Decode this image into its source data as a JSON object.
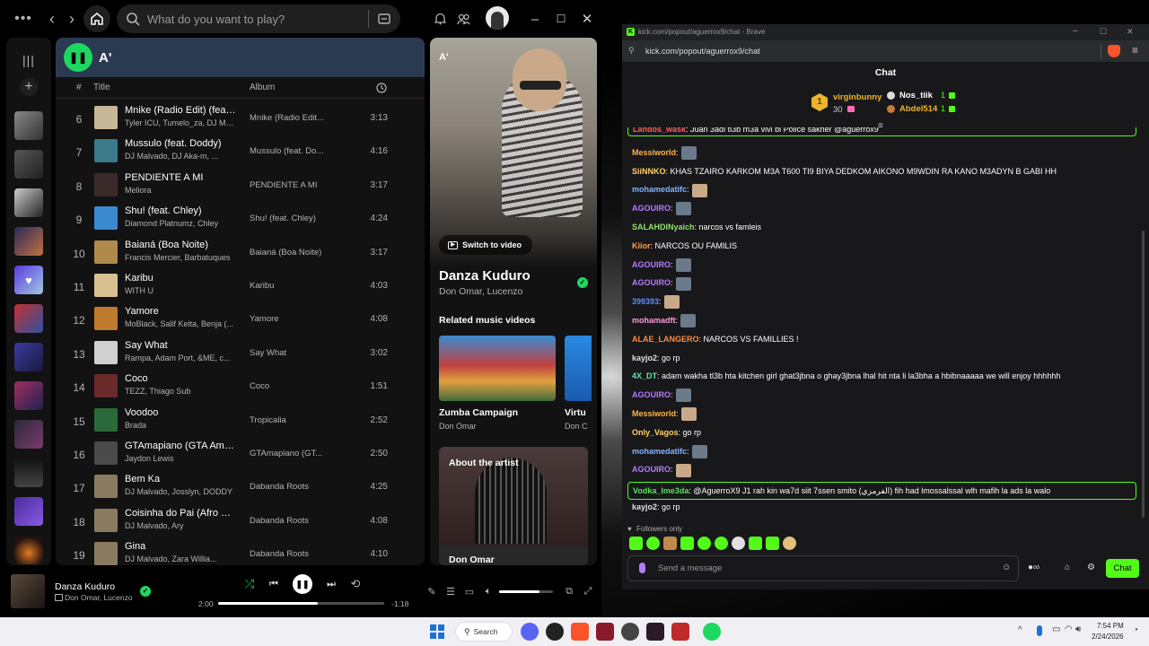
{
  "spotify": {
    "search_placeholder": "What do you want to play?",
    "playlist_title": "A'",
    "columns": {
      "num": "#",
      "title": "Title",
      "album": "Album"
    },
    "tracks": [
      {
        "num": "6",
        "title": "Mnike (Radio Edit) (feat....",
        "artist": "Tyler ICU, Tumelo_za, DJ Ma...",
        "album": "Mnike (Radio Edit...",
        "duration": "3:13",
        "color": "#c9b79a"
      },
      {
        "num": "7",
        "title": "Mussulo (feat. Doddy)",
        "artist": "DJ Malvado, DJ Aka-m, ...",
        "album": "Mussulo (feat. Do...",
        "duration": "4:16",
        "color": "#3a7a8a"
      },
      {
        "num": "8",
        "title": "PENDIENTE A MI",
        "artist": "Meliora",
        "album": "PENDIENTE A MI",
        "duration": "3:17",
        "color": "#3a2a2a"
      },
      {
        "num": "9",
        "title": "Shu! (feat. Chley)",
        "artist": "Diamond Platnumz, Chley",
        "album": "Shu! (feat. Chley)",
        "duration": "4:24",
        "color": "#3a8ad0"
      },
      {
        "num": "10",
        "title": "Baianá (Boa Noite)",
        "artist": "Francis Mercier, Barbatuques",
        "album": "Baianá (Boa Noite)",
        "duration": "3:17",
        "color": "#b08a4a"
      },
      {
        "num": "11",
        "title": "Karibu",
        "artist": "WITH U",
        "album": "Karibu",
        "duration": "4:03",
        "color": "#d8c090"
      },
      {
        "num": "12",
        "title": "Yamore",
        "artist": "MoBlack, Salif Keita, Benja (...",
        "album": "Yamore",
        "duration": "4:08",
        "color": "#c07a30"
      },
      {
        "num": "13",
        "title": "Say What",
        "artist": "Rampa, Adam Port, &ME, c...",
        "album": "Say What",
        "duration": "3:02",
        "color": "#d0d0d0"
      },
      {
        "num": "14",
        "title": "Coco",
        "artist": "TEZZ, Thiago Sub",
        "album": "Coco",
        "duration": "1:51",
        "color": "#6a2a2a"
      },
      {
        "num": "15",
        "title": "Voodoo",
        "artist": "Brada",
        "album": "Tropicalia",
        "duration": "2:52",
        "color": "#2a6a3a"
      },
      {
        "num": "16",
        "title": "GTAmapiano (GTA Ama...",
        "artist": "Jaydon Lewis",
        "album": "GTAmapiano (GT...",
        "duration": "2:50",
        "color": "#4a4a4a"
      },
      {
        "num": "17",
        "title": "Bem Ka",
        "artist": "DJ Malvado, Josslyn, DODDY",
        "album": "Dabanda Roots",
        "duration": "4:25",
        "color": "#8a7a60"
      },
      {
        "num": "18",
        "title": "Coisinha do Pai (Afro Sa...",
        "artist": "DJ Malvado, Ary",
        "album": "Dabanda Roots",
        "duration": "4:08",
        "color": "#8a7a60"
      },
      {
        "num": "19",
        "title": "Gina",
        "artist": "DJ Malvado, Zara Willia...",
        "album": "Dabanda Roots",
        "duration": "4:10",
        "color": "#8a7a60"
      }
    ],
    "np_panel": {
      "title": "A'",
      "switch_video": "Switch to video",
      "song": "Danza Kuduro",
      "artists": "Don Omar, Lucenzo",
      "related": "Related music videos",
      "video1_title": "Zumba Campaign",
      "video1_artist": "Don Omar",
      "video2_title": "Virtu",
      "video2_artist": "Don C",
      "about": "About the artist",
      "about_name": "Don Omar"
    },
    "player": {
      "song": "Danza Kuduro",
      "artists": "Don Omar, Lucenzo",
      "elapsed": "2:00",
      "remaining": "-1:18",
      "progress": 0.6,
      "volume": 0.75
    }
  },
  "kick": {
    "window_title": "kick.com/popout/aguerrox9/chat - Brave",
    "url": "kick.com/popout/aguerrox9/chat",
    "header": "Chat",
    "leaderboard": [
      {
        "name": "virginbunny",
        "count": "30"
      },
      {
        "name": "Nos_tiik",
        "count": "1"
      },
      {
        "name": "Abdel514",
        "count": "1"
      }
    ],
    "messages": [
      {
        "user": "Landos_wask",
        "text": ": Juan 3adi tl3b m3a vivi bi Police sakher @aguerrox9",
        "color": "#ff5e5e",
        "emote": false
      },
      {
        "user": "Messiworld",
        "text": ":",
        "color": "#ffb347",
        "emote": true
      },
      {
        "user": "SiiNNKO",
        "text": ": KHAS TZAIRO KARKOM M3A T600 TI9 BIYA DEDKOM AIKONO M9WDIN RA KANO M3ADYN B GABI HH",
        "color": "#ffd166",
        "emote": false
      },
      {
        "user": "mohamedatifc",
        "text": ":",
        "color": "#7fb6ff",
        "emote": true
      },
      {
        "user": "AGOUIRO",
        "text": ":",
        "color": "#b57bff",
        "emote": true
      },
      {
        "user": "SALAHDINyaich",
        "text": ": narcos vs famleis",
        "color": "#8fe36a",
        "emote": false
      },
      {
        "user": "Kiior",
        "text": ": NARCOS OU FAMILIS",
        "color": "#ff9f43",
        "emote": false
      },
      {
        "user": "AGOUIRO",
        "text": ":",
        "color": "#b57bff",
        "emote": true
      },
      {
        "user": "AGOUIRO",
        "text": ":",
        "color": "#b57bff",
        "emote": true
      },
      {
        "user": "399393",
        "text": ":",
        "color": "#5b8cff",
        "emote": true
      },
      {
        "user": "mohamadft",
        "text": ":",
        "color": "#ff9ad5",
        "emote": true
      },
      {
        "user": "ALAE_LANGERO",
        "text": ": NARCOS VS FAMILLIES !",
        "color": "#ff8c42",
        "emote": false
      },
      {
        "user": "kayjo2",
        "text": ": go rp",
        "color": "#e0e0e0",
        "emote": false
      },
      {
        "user": "4X_DT",
        "text": ": adam wakha tl3b hta kitchen girl ghat3jbna o ghay3jbna lhal hit nta li la3bha a hbibnaaaaa we will enjoy hhhhhh",
        "color": "#5be3a8",
        "emote": false
      },
      {
        "user": "AGOUIRO",
        "text": ":",
        "color": "#b57bff",
        "emote": true
      },
      {
        "user": "Messiworld",
        "text": ":",
        "color": "#ffb347",
        "emote": true
      },
      {
        "user": "Only_Vagos",
        "text": ": go rp",
        "color": "#ffd166",
        "emote": false
      },
      {
        "user": "mohamedatifc",
        "text": ":",
        "color": "#7fb6ff",
        "emote": true
      },
      {
        "user": "AGOUIRO",
        "text": ":",
        "color": "#b57bff",
        "emote": true
      },
      {
        "user": "Vodka_lme3da",
        "text": ": @AguerroX9 J1 rah kin wa7d siit 7ssen smito (الفرمزي) fih had lmossalssal wlh mafih la ads la walo",
        "color": "#5be35b",
        "emote": false
      },
      {
        "user": "kayjo2",
        "text": ": go rp",
        "color": "#e0e0e0",
        "emote": false
      }
    ],
    "followers_only": "Followers only",
    "send_placeholder": "Send a message",
    "chat_button": "Chat"
  },
  "taskbar": {
    "search": "Search",
    "time": "7:54 PM",
    "date": "2/24/2026"
  }
}
